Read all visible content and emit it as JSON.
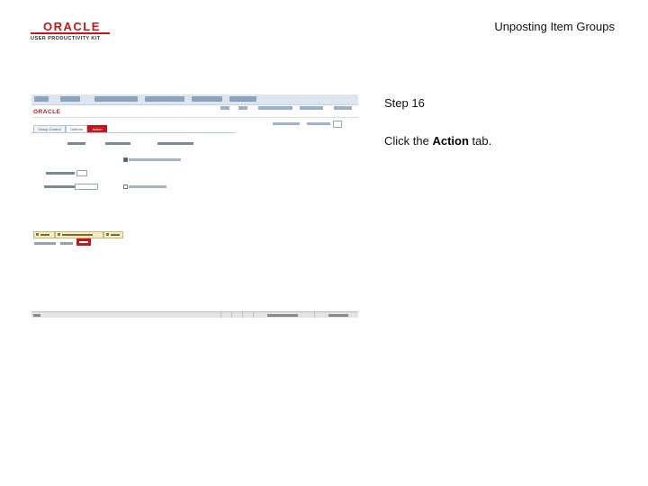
{
  "header": {
    "logo_word": "ORACLE",
    "logo_tagline": "USER PRODUCTIVITY KIT",
    "doc_title": "Unposting Item Groups"
  },
  "instructions": {
    "step": "Step 16",
    "text_before": "Click the ",
    "emphasis": "Action",
    "text_after": " tab."
  },
  "screenshot": {
    "tabs": [
      {
        "label": "Group Control",
        "state": "normal"
      },
      {
        "label": "Options",
        "state": "active"
      },
      {
        "label": "Action",
        "state": "highlighted"
      }
    ]
  },
  "colors": {
    "oracle_red": "#c4161c",
    "nav_blue": "#dde6ef"
  },
  "icons": [
    "oracle-logo-icon",
    "save-icon",
    "refresh-icon"
  ]
}
